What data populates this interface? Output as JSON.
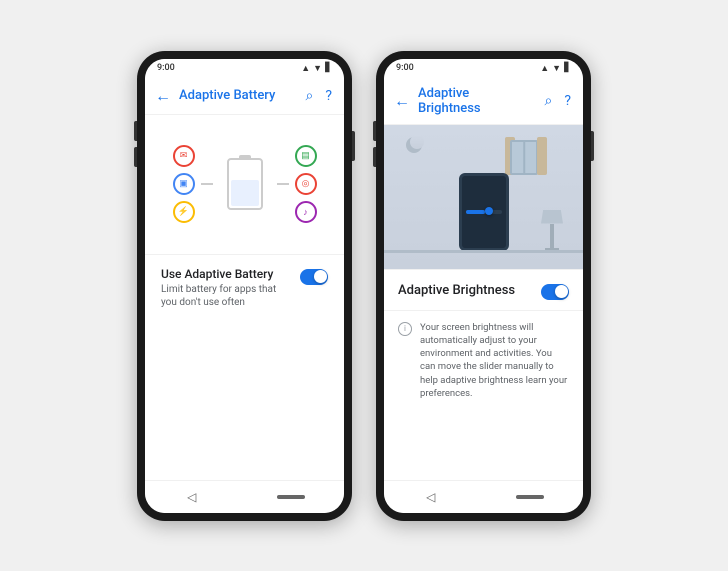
{
  "phone1": {
    "statusBar": {
      "time": "9:00",
      "icons": "▲▼ ●▋"
    },
    "appBar": {
      "title": "Adaptive Battery",
      "backLabel": "←",
      "searchLabel": "🔍",
      "helpLabel": "?"
    },
    "illustration": {
      "altText": "Battery diagram with app icons"
    },
    "setting": {
      "title": "Use Adaptive Battery",
      "subtitle": "Limit battery for apps that you don't use often",
      "toggleOn": true
    },
    "navIcons": {
      "back": "◁",
      "home": "—"
    }
  },
  "phone2": {
    "statusBar": {
      "time": "9:00",
      "icons": "▲▼ ●▋"
    },
    "appBar": {
      "title": "Adaptive Brightness",
      "backLabel": "←",
      "searchLabel": "🔍",
      "helpLabel": "?"
    },
    "illustration": {
      "altText": "Room scene with phone showing brightness slider"
    },
    "setting": {
      "title": "Adaptive Brightness",
      "toggleOn": true
    },
    "infoText": "Your screen brightness will automatically adjust to your environment and activities. You can move the slider manually to help adaptive brightness learn your preferences.",
    "navIcons": {
      "back": "◁",
      "home": "—"
    }
  }
}
